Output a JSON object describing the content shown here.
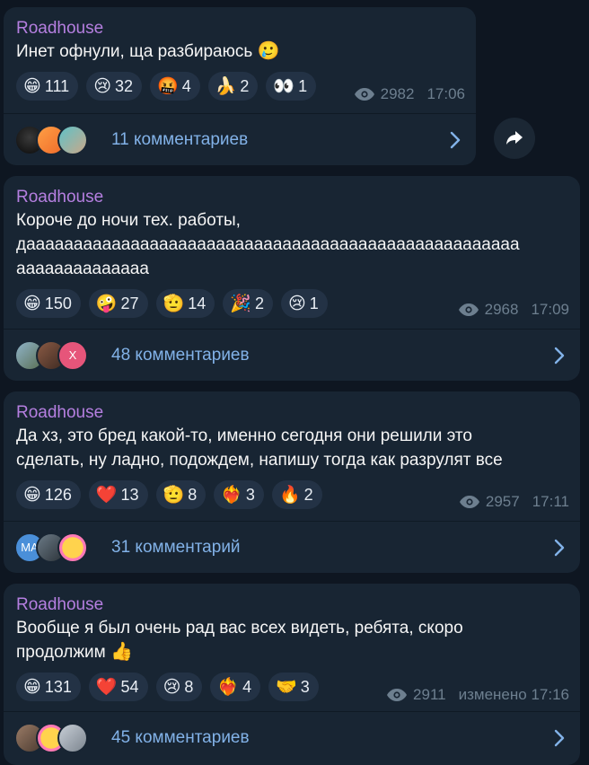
{
  "messages": [
    {
      "author": "Roadhouse",
      "lines": [
        "Инет офнули, ща разбираюсь"
      ],
      "inline_emoji": "🥲",
      "reactions": [
        {
          "emoji": "😁",
          "count": "111"
        },
        {
          "emoji": "😢",
          "count": "32"
        },
        {
          "emoji": "🤬",
          "count": "4"
        },
        {
          "emoji": "🍌",
          "count": "2"
        },
        {
          "emoji": "👀",
          "count": "1"
        }
      ],
      "views": "2982",
      "time": "17:06",
      "comments_label": "11 комментариев"
    },
    {
      "author": "Roadhouse",
      "lines": [
        "Короче до ночи тех. работы,",
        "даааааааааааааааааааааааааааааааааааааааааааааааааааа",
        "аааааааааааааа"
      ],
      "inline_emoji": "",
      "reactions": [
        {
          "emoji": "😁",
          "count": "150"
        },
        {
          "emoji": "🤪",
          "count": "27"
        },
        {
          "emoji": "🫡",
          "count": "14"
        },
        {
          "emoji": "🎉",
          "count": "2"
        },
        {
          "emoji": "😢",
          "count": "1"
        }
      ],
      "views": "2968",
      "time": "17:09",
      "comments_label": "48 комментариев"
    },
    {
      "author": "Roadhouse",
      "lines": [
        "Да хз, это бред какой-то, именно сегодня они решили это",
        "сделать, ну ладно, подождем, напишу тогда как разрулят все"
      ],
      "inline_emoji": "",
      "reactions": [
        {
          "emoji": "😁",
          "count": "126"
        },
        {
          "emoji": "❤️",
          "count": "13"
        },
        {
          "emoji": "🫡",
          "count": "8"
        },
        {
          "emoji": "❤️‍🔥",
          "count": "3"
        },
        {
          "emoji": "🔥",
          "count": "2"
        }
      ],
      "views": "2957",
      "time": "17:11",
      "comments_label": "31 комментарий"
    },
    {
      "author": "Roadhouse",
      "lines": [
        "Вообще я был очень рад вас всех видеть, ребята, скоро",
        "продолжим"
      ],
      "inline_emoji": "👍",
      "reactions": [
        {
          "emoji": "😁",
          "count": "131"
        },
        {
          "emoji": "❤️",
          "count": "54"
        },
        {
          "emoji": "😢",
          "count": "8"
        },
        {
          "emoji": "❤️‍🔥",
          "count": "4"
        },
        {
          "emoji": "🤝",
          "count": "3"
        }
      ],
      "views": "2911",
      "time": "изменено 17:16",
      "comments_label": "45 комментариев"
    }
  ],
  "avatar_initials": {
    "ma": "МА",
    "x": "X"
  },
  "colors": {
    "background": "#0e1621",
    "bubble": "#182533",
    "author": "#b57fe0",
    "link": "#82b2e8",
    "meta": "#6d7f8f",
    "reaction_bg": "#233245"
  },
  "icons": {
    "views": "eye-icon",
    "chevron": "chevron-right-icon",
    "share": "share-arrow-icon"
  }
}
